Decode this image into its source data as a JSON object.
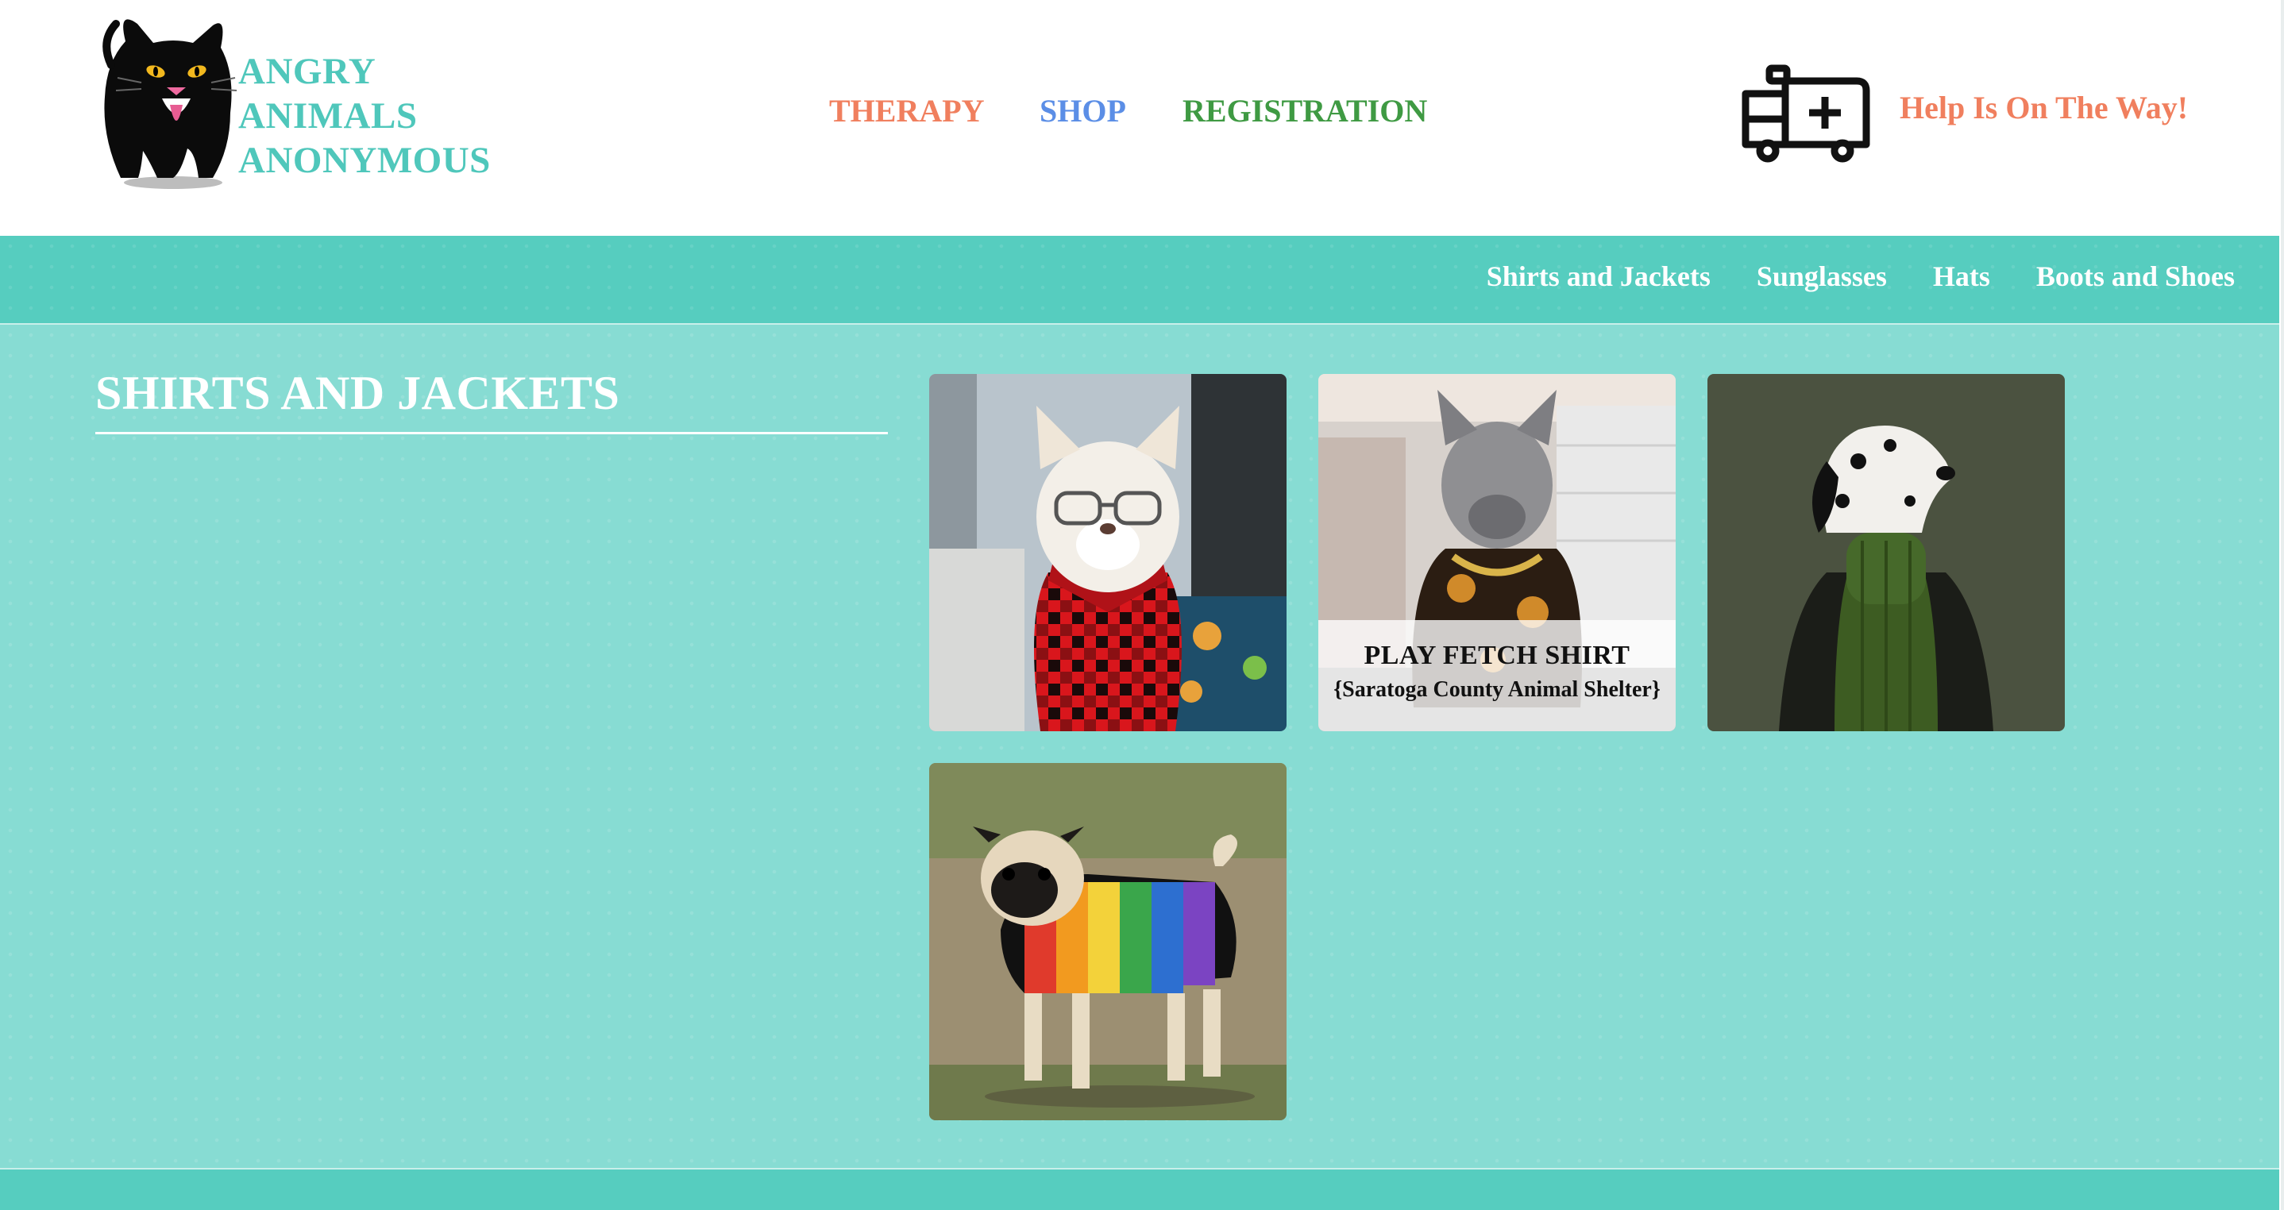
{
  "brand": {
    "lines": [
      "ANGRY",
      "ANIMALS",
      "ANONYMOUS"
    ],
    "logo_icon": "black-cat-logo"
  },
  "topnav": {
    "items": [
      {
        "label": "THERAPY",
        "color": "#f07f5e"
      },
      {
        "label": "SHOP",
        "color": "#5b8ee6"
      },
      {
        "label": "REGISTRATION",
        "color": "#3f9a43"
      }
    ]
  },
  "help": {
    "label": "Help Is On The Way!",
    "color": "#f07f5e",
    "icon": "ambulance-icon"
  },
  "subnav": {
    "items": [
      "Shirts and Jackets",
      "Sunglasses",
      "Hats",
      "Boots and Shoes"
    ]
  },
  "main": {
    "title": "SHIRTS AND JACKETS",
    "products": [
      {
        "image": "shiba-inu-in-glasses-and-red-plaid-shirt",
        "name": "",
        "org": ""
      },
      {
        "image": "french-bulldog-in-baroque-shirt-with-gold-chain",
        "name": "PLAY FETCH SHIRT",
        "org": "{Saratoga County Animal Shelter}"
      },
      {
        "image": "dalmatian-in-green-turtleneck-and-leather-jacket",
        "name": "",
        "org": ""
      },
      {
        "image": "pug-in-rainbow-striped-sweater",
        "name": "",
        "org": ""
      }
    ]
  },
  "colors": {
    "brand_teal": "#4fc7bb",
    "subnav_bg": "#56cdbf",
    "main_bg": "#87dcd3"
  }
}
